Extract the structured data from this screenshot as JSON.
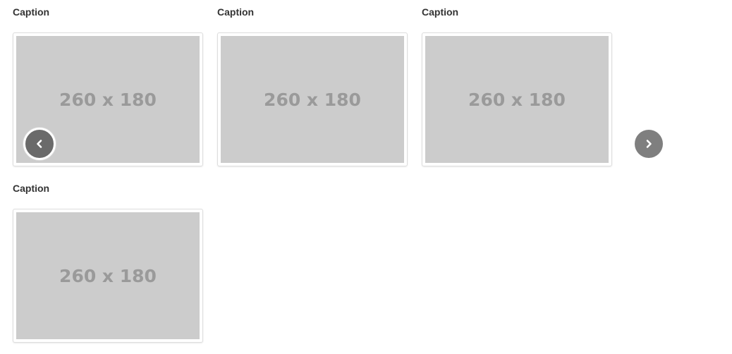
{
  "carousel": {
    "items": [
      {
        "caption": "Caption",
        "placeholder_text": "260 x 180"
      },
      {
        "caption": "Caption",
        "placeholder_text": "260 x 180"
      },
      {
        "caption": "Caption",
        "placeholder_text": "260 x 180"
      },
      {
        "caption": "Caption",
        "placeholder_text": "260 x 180"
      }
    ],
    "prev_icon": "chevron-left-icon",
    "next_icon": "chevron-right-icon"
  },
  "colors": {
    "placeholder_bg": "#cccccc",
    "placeholder_text": "#9a9a9a",
    "nav_button": "#7f7f7f"
  }
}
